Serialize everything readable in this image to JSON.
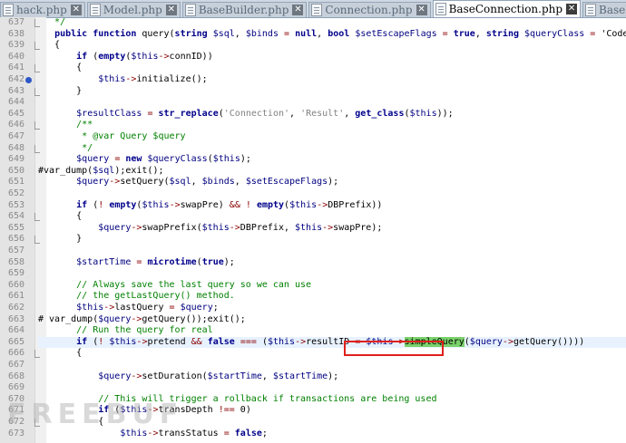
{
  "tabs": [
    {
      "label": "hack.php",
      "active": false
    },
    {
      "label": "Model.php",
      "active": false
    },
    {
      "label": "BaseBuilder.php",
      "active": false
    },
    {
      "label": "Connection.php",
      "active": false
    },
    {
      "label": "BaseConnection.php",
      "active": true
    },
    {
      "label": "BaseResult.php",
      "active": false
    }
  ],
  "tab_close_glyph": "✕",
  "editor": {
    "breakpoint_line": 642,
    "highlighted_line": 665,
    "lines": [
      {
        "n": "637",
        "t": "   */"
      },
      {
        "n": "638",
        "t": "   public function query(string $sql, $binds = null, bool $setEscapeFlags = true, string $queryClass = 'CodeIgniter"
      },
      {
        "n": "639",
        "t": "   {"
      },
      {
        "n": "640",
        "t": "       if (empty($this->connID))"
      },
      {
        "n": "641",
        "t": "       {"
      },
      {
        "n": "642",
        "t": "           $this->initialize();"
      },
      {
        "n": "643",
        "t": "       }"
      },
      {
        "n": "644",
        "t": ""
      },
      {
        "n": "645",
        "t": "       $resultClass = str_replace('Connection', 'Result', get_class($this));"
      },
      {
        "n": "646",
        "t": "       /**"
      },
      {
        "n": "647",
        "t": "        * @var Query $query"
      },
      {
        "n": "648",
        "t": "        */"
      },
      {
        "n": "649",
        "t": "       $query = new $queryClass($this);"
      },
      {
        "n": "650",
        "t": "#var_dump($sql);exit();"
      },
      {
        "n": "651",
        "t": "       $query->setQuery($sql, $binds, $setEscapeFlags);"
      },
      {
        "n": "652",
        "t": ""
      },
      {
        "n": "653",
        "t": "       if (! empty($this->swapPre) && ! empty($this->DBPrefix))"
      },
      {
        "n": "654",
        "t": "       {"
      },
      {
        "n": "655",
        "t": "           $query->swapPrefix($this->DBPrefix, $this->swapPre);"
      },
      {
        "n": "656",
        "t": "       }"
      },
      {
        "n": "657",
        "t": ""
      },
      {
        "n": "658",
        "t": "       $startTime = microtime(true);"
      },
      {
        "n": "659",
        "t": ""
      },
      {
        "n": "660",
        "t": "       // Always save the last query so we can use"
      },
      {
        "n": "661",
        "t": "       // the getLastQuery() method."
      },
      {
        "n": "662",
        "t": "       $this->lastQuery = $query;"
      },
      {
        "n": "663",
        "t": "# var_dump($query->getQuery());exit();"
      },
      {
        "n": "664",
        "t": "       // Run the query for real"
      },
      {
        "n": "665",
        "t": "       if (! $this->pretend && false === ($this->resultID = $this->simpleQuery($query->getQuery())))"
      },
      {
        "n": "666",
        "t": "       {"
      },
      {
        "n": "667",
        "t": ""
      },
      {
        "n": "668",
        "t": "           $query->setDuration($startTime, $startTime);"
      },
      {
        "n": "669",
        "t": ""
      },
      {
        "n": "670",
        "t": "           // This will trigger a rollback if transactions are being used"
      },
      {
        "n": "671",
        "t": "           if ($this->transDepth !== 0)"
      },
      {
        "n": "672",
        "t": "           {"
      },
      {
        "n": "673",
        "t": "               $this->transStatus = false;"
      }
    ]
  },
  "selected_text": "simpleQuery",
  "watermark": "FREEBUF",
  "colors": {
    "keyword": "#00008b",
    "comment": "#008000",
    "string": "#808080",
    "selection": "#7ad26b",
    "annotation_box": "#e0201c"
  }
}
